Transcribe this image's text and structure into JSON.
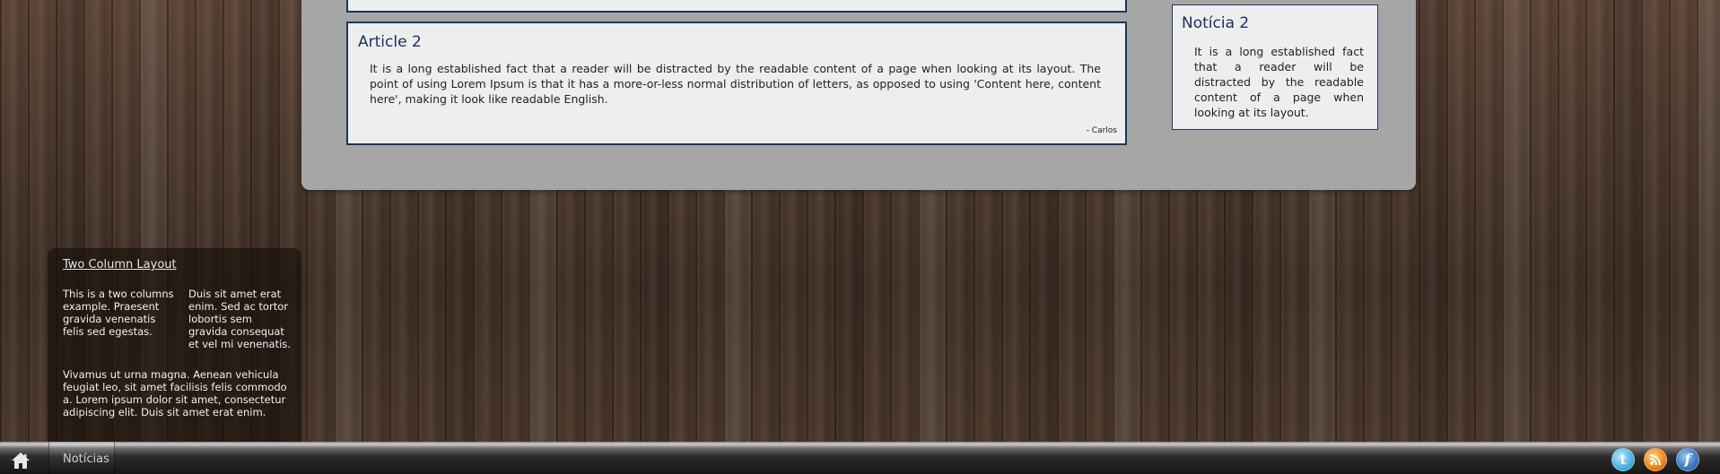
{
  "articles": {
    "article2": {
      "title": "Article 2",
      "body": "It is a long established fact that a reader will be distracted by the readable content of a page when looking at its layout. The point of using Lorem Ipsum is that it has a more-or-less normal distribution of letters, as opposed to using 'Content here, content here', making it look like readable English.",
      "author": "- Carlos"
    }
  },
  "news": {
    "title": "Notícia 2",
    "body": "It is a long established fact that a reader will be distracted by the readable content of a page when looking at its layout."
  },
  "side_panel": {
    "title": "Two Column Layout",
    "col_left": "This is a two columns example. Praesent gravida venenatis felis sed egestas.",
    "col_right": "Duis sit amet erat enim. Sed ac tortor lobortis sem gravida consequat et vel mi venenatis.",
    "paragraph": "Vivamus ut urna magna. Aenean vehicula feugiat leo, sit amet facilisis felis commodo a. Lorem ipsum dolor sit amet, consectetur adipiscing elit. Duis sit amet erat enim."
  },
  "bottom_bar": {
    "home_icon": "home-icon",
    "nav_label": "Notícias",
    "social": [
      {
        "name": "twitter-icon",
        "glyph": "t",
        "color": "#53b8e8"
      },
      {
        "name": "rss-icon",
        "color": "#f08a20"
      },
      {
        "name": "facebook-icon",
        "glyph": "f",
        "color": "#3f7fc8"
      }
    ]
  },
  "colors": {
    "container_bg": "#a6a6a6",
    "box_bg": "#eeeeee",
    "border_accent": "#1c3563",
    "title_color": "#16305e"
  }
}
